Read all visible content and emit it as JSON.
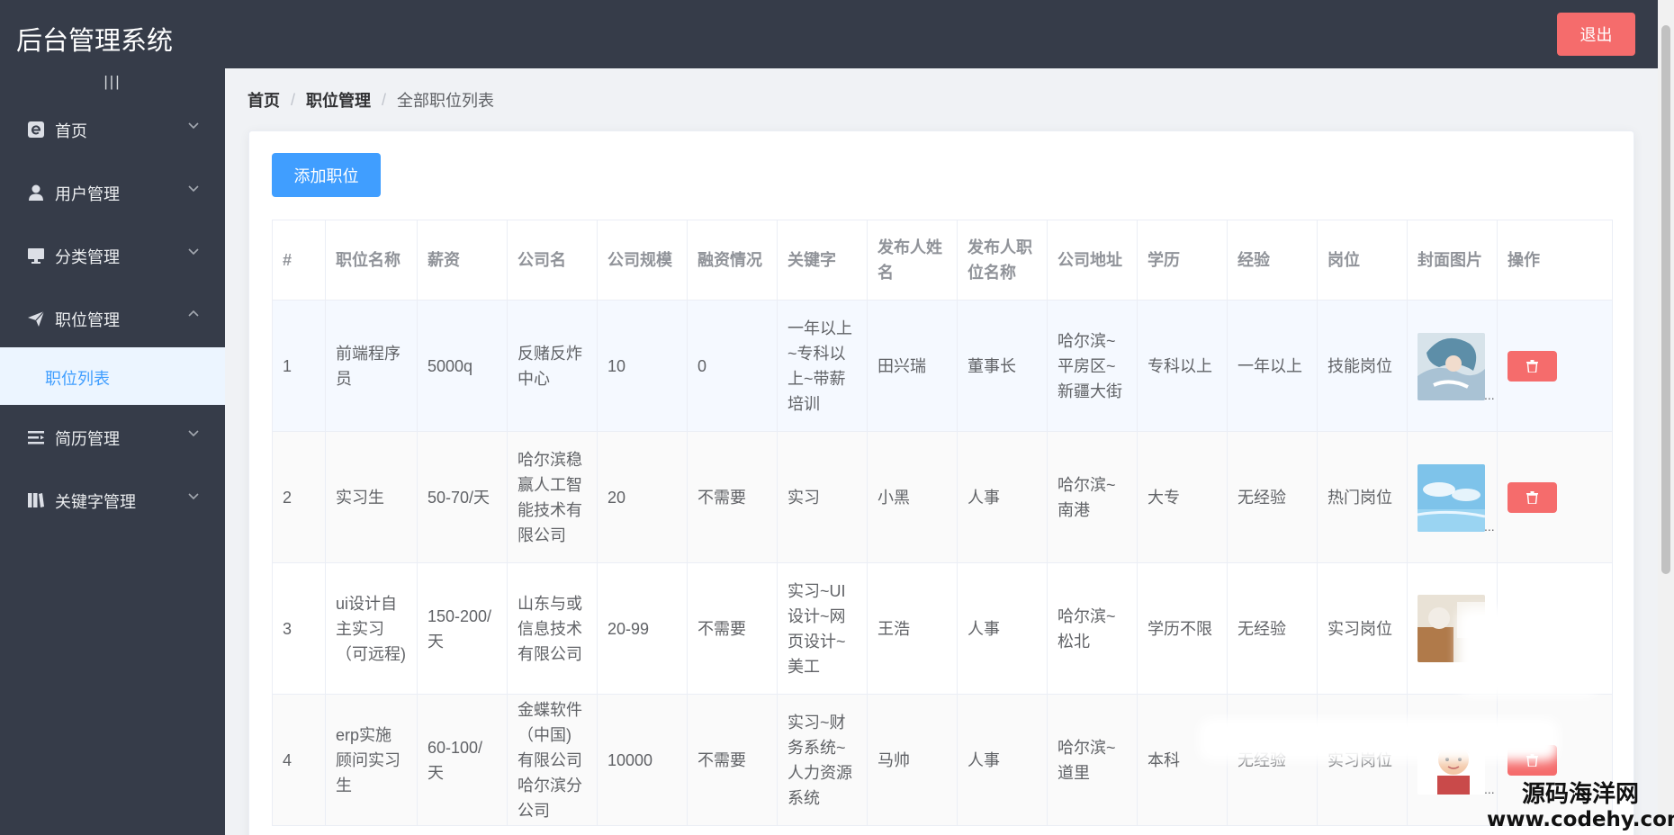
{
  "header": {
    "app_title": "后台管理系统",
    "logout_label": "退出"
  },
  "sidebar": {
    "collapse_icon": "|||",
    "items": [
      {
        "label": "首页",
        "icon": "home-icon"
      },
      {
        "label": "用户管理",
        "icon": "user-icon"
      },
      {
        "label": "分类管理",
        "icon": "monitor-icon"
      },
      {
        "label": "职位管理",
        "icon": "paper-plane-icon",
        "expanded": true
      },
      {
        "label": "简历管理",
        "icon": "list-icon"
      },
      {
        "label": "关键字管理",
        "icon": "book-icon"
      }
    ],
    "active_subitem": "职位列表"
  },
  "breadcrumb": {
    "items": [
      "首页",
      "职位管理"
    ],
    "current": "全部职位列表",
    "separator": "/"
  },
  "toolbar": {
    "add_label": "添加职位"
  },
  "table": {
    "columns": [
      "#",
      "职位名称",
      "薪资",
      "公司名",
      "公司规模",
      "融资情况",
      "关键字",
      "发布人姓名",
      "发布人职位名称",
      "公司地址",
      "学历",
      "经验",
      "岗位",
      "封面图片",
      "操作"
    ],
    "rows": [
      {
        "no": "1",
        "title": "前端程序员",
        "salary": "5000q",
        "company": "反赌反炸中心",
        "size": "10",
        "funding": "0",
        "keywords": "一年以上~专科以上~带薪培训",
        "publisher": "田兴瑞",
        "publisher_title": "董事长",
        "address": "哈尔滨~平房区~新疆大街",
        "education": "专科以上",
        "experience": "一年以上",
        "post": "技能岗位",
        "cover_icon": "anime-cover-thumbnail"
      },
      {
        "no": "2",
        "title": "实习生",
        "salary": "50-70/天",
        "company": "哈尔滨稳赢人工智能技术有限公司",
        "size": "20",
        "funding": "不需要",
        "keywords": "实习",
        "publisher": "小黑",
        "publisher_title": "人事",
        "address": "哈尔滨~南港",
        "education": "大专",
        "experience": "无经验",
        "post": "热门岗位",
        "cover_icon": "sky-cover-thumbnail"
      },
      {
        "no": "3",
        "title": "ui设计自主实习（可远程)",
        "salary": "150-200/天",
        "company": "山东与或信息技术有限公司",
        "size": "20-99",
        "funding": "不需要",
        "keywords": "实习~UI设计~网页设计~美工",
        "publisher": "王浩",
        "publisher_title": "人事",
        "address": "哈尔滨~松北",
        "education": "学历不限",
        "experience": "无经验",
        "post": "实习岗位",
        "cover_icon": "photo-cover-thumbnail"
      },
      {
        "no": "4",
        "title": "erp实施顾问实习生",
        "salary": "60-100/天",
        "company": "金蝶软件（中国)有限公司哈尔滨分公司",
        "size": "10000",
        "funding": "不需要",
        "keywords": "实习~财务系统~人力资源系统",
        "publisher": "马帅",
        "publisher_title": "人事",
        "address": "哈尔滨~道里",
        "education": "本科",
        "experience": "无经验",
        "post": "实习岗位",
        "cover_icon": "avatar-cover-thumbnail"
      }
    ],
    "ellipsis": "..."
  },
  "watermark": {
    "name": "源码海洋网",
    "url": "www.codehy.com"
  },
  "colors": {
    "header_bg": "#363c49",
    "sidebar_bg": "#363c49",
    "primary": "#409eff",
    "danger": "#f56c6c",
    "submenu_active_bg": "#ecf5ff"
  }
}
